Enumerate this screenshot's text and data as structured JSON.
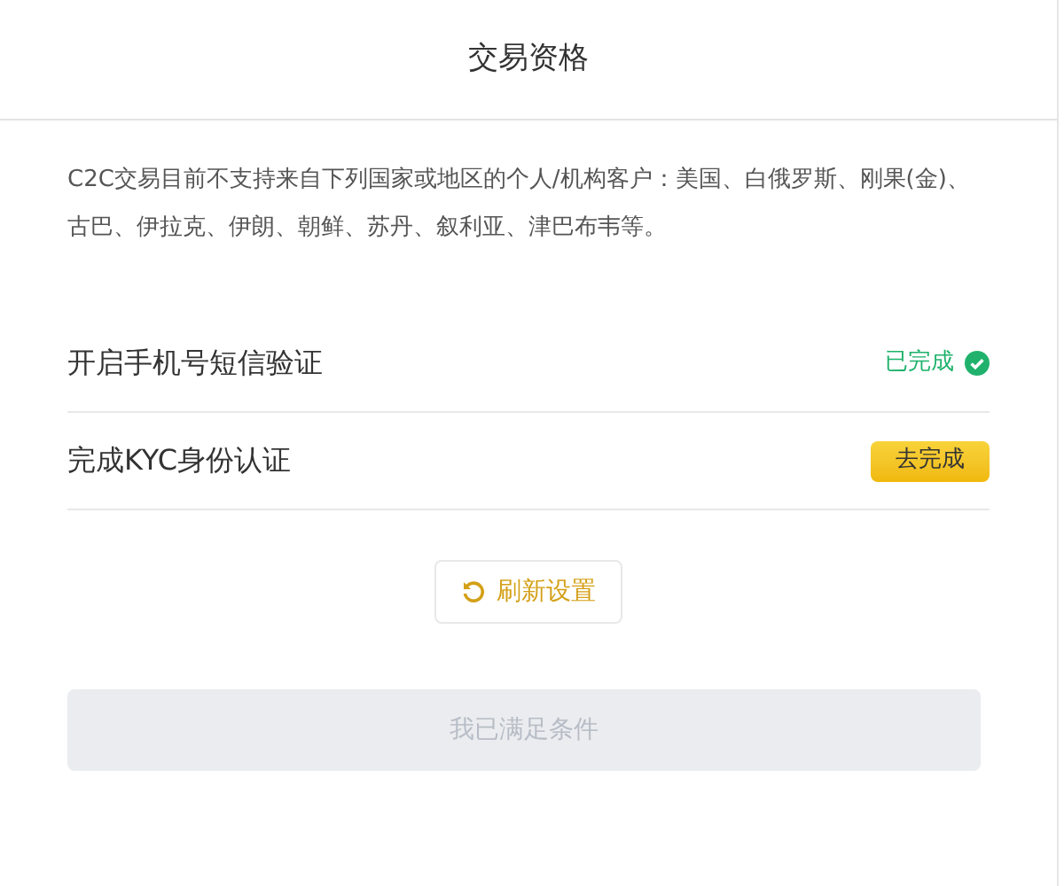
{
  "dialog": {
    "title": "交易资格"
  },
  "notice": "C2C交易目前不支持来自下列国家或地区的个人/机构客户：美国、白俄罗斯、刚果(金)、古巴、伊拉克、伊朗、朝鲜、苏丹、叙利亚、津巴布韦等。",
  "requirements": [
    {
      "label": "开启手机号短信验证",
      "kind": "done",
      "status": "已完成"
    },
    {
      "label": "完成KYC身份认证",
      "kind": "todo",
      "status": "去完成"
    }
  ],
  "refresh_button": {
    "label": "刷新设置"
  },
  "submit_button": {
    "label": "我已满足条件",
    "disabled": true
  }
}
